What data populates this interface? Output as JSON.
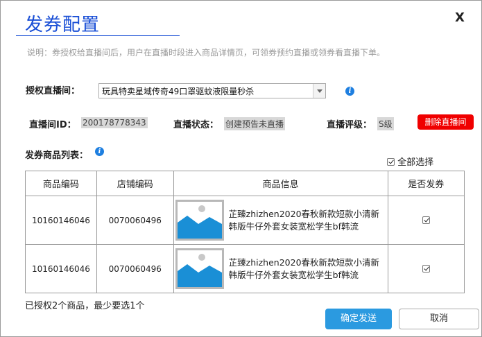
{
  "dialog": {
    "title": "发券配置",
    "close_label": "X",
    "description": "说明：券授权给直播间后，用户在直播时段进入商品详情页，可领券预约直播或领券看直播下单。"
  },
  "room": {
    "label": "授权直播间：",
    "selected": "玩具特卖星域传奇49口罩驱蚊液限量秒杀"
  },
  "room_info": {
    "id_label": "直播间ID：",
    "id_value": "200178778343",
    "status_label": "直播状态：",
    "status_value": "创建预告未直播",
    "rating_label": "直播评级：",
    "rating_value": "S级",
    "delete_label": "删除直播间"
  },
  "product_list": {
    "label": "发券商品列表：",
    "select_all_label": "全部选择",
    "headers": [
      "商品编码",
      "店铺编码",
      "商品信息",
      "是否发券"
    ],
    "rows": [
      {
        "code": "10160146046",
        "shop_code": "0070060496",
        "info": "芷臻zhizhen2020春秋新款短款小清新韩版牛仔外套女装宽松学生bf韩流",
        "checked": true
      },
      {
        "code": "10160146046",
        "shop_code": "0070060496",
        "info": "芷臻zhizhen2020春秋新款短款小清新韩版牛仔外套女装宽松学生bf韩流",
        "checked": true
      }
    ]
  },
  "footer": {
    "note": "已授权2个商品，最少要选1个",
    "confirm_label": "确定发送",
    "cancel_label": "取消"
  },
  "colors": {
    "title_blue": "#1a4fd6",
    "info_icon_blue": "#1e7fe0",
    "delete_red": "#f00000",
    "confirm_blue": "#2b9ae0",
    "thumb_blue": "#1a8fd6"
  },
  "icons": {
    "info": "info-icon",
    "close": "close-icon",
    "image_placeholder": "image-placeholder-icon",
    "dropdown": "chevron-down-icon"
  }
}
